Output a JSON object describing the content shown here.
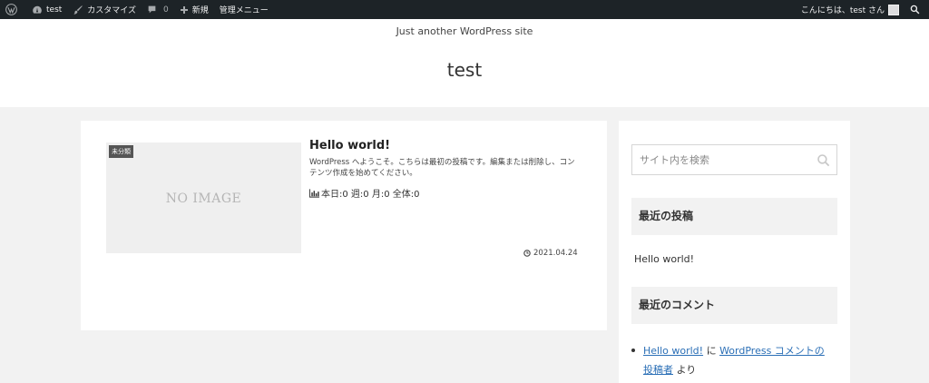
{
  "adminbar": {
    "site_name": "test",
    "customize": "カスタマイズ",
    "comments_count": "0",
    "new_label": "新規",
    "admin_menu": "管理メニュー",
    "greeting": "こんにちは、test さん"
  },
  "header": {
    "tagline": "Just another WordPress site",
    "title": "test"
  },
  "post": {
    "category": "未分類",
    "thumb_text": "NO IMAGE",
    "title": "Hello world!",
    "excerpt": "WordPress へようこそ。こちらは最初の投稿です。編集または削除し、コンテンツ作成を始めてください。",
    "views": "本日:0 週:0 月:0 全体:0",
    "date": "2021.04.24"
  },
  "sidebar": {
    "search_placeholder": "サイト内を検索",
    "recent_posts_title": "最近の投稿",
    "recent_post": "Hello world!",
    "recent_comments_title": "最近のコメント",
    "comment": {
      "post_link": "Hello world!",
      "connector": " に ",
      "author_link": "WordPress コメントの投稿者",
      "suffix": " より"
    }
  }
}
